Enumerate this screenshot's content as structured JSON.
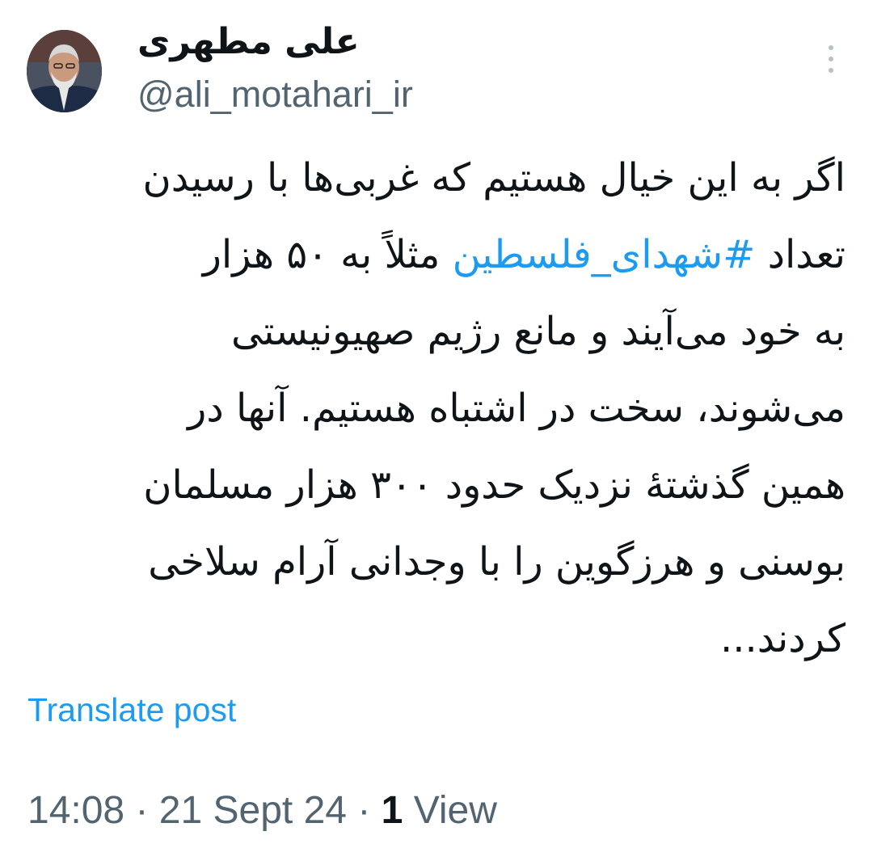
{
  "author": {
    "display_name": "علی مطهری",
    "handle": "@ali_motahari_ir"
  },
  "post": {
    "lines": [
      {
        "text": "اگر به این خیال هستیم که غربی‌ها با رسیدن"
      },
      {
        "pre": "تعداد ",
        "hashtag": "#شهدای_فلسطین",
        "post": " مثلاً به ۵۰ هزار"
      },
      {
        "text": "به خود می‌آیند و مانع رژیم صهیونیستی"
      },
      {
        "text": "می‌شوند، سخت در اشتباه هستیم. آنها در"
      },
      {
        "text": "همین گذشتهٔ نزدیک حدود ۳۰۰ هزار مسلمان"
      },
      {
        "text": "بوسنی و هرزگوین را با وجدانی آرام سلاخی"
      },
      {
        "text": "کردند..."
      }
    ],
    "translate_label": "Translate post"
  },
  "meta": {
    "time": "14:08",
    "separator": "·",
    "date": "21 Sept 24",
    "view_count": "1",
    "view_label": "View"
  },
  "icons": {
    "more": "more-vertical-icon"
  },
  "colors": {
    "link": "#1d9bf0",
    "text": "#0f1419",
    "secondary": "#536471"
  }
}
